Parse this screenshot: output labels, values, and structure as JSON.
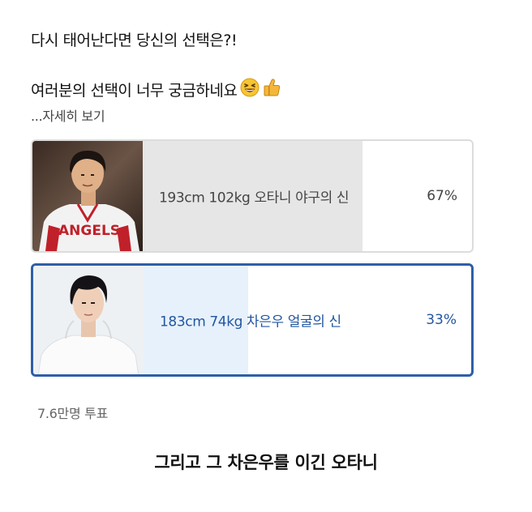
{
  "post": {
    "title": "다시 태어난다면 당신의 선택은?!",
    "body": "여러분의 선택이 너무 궁금하네요",
    "more_link": "...자세히 보기"
  },
  "poll": {
    "options": [
      {
        "label": "193cm 102kg 오타니 야구의 신",
        "percent": "67%",
        "selected": false
      },
      {
        "label": "183cm 74kg 차은우 얼굴의 신",
        "percent": "33%",
        "selected": true
      }
    ],
    "vote_count": "7.6만명 투표"
  },
  "caption": "그리고 그 차은우를 이긴 오타니",
  "colors": {
    "selected_border": "#2e5fa8",
    "selected_text": "#2356a0",
    "unselected_border": "#dcdcdc",
    "unselected_fill": "#e6e6e6",
    "selected_fill": "#e7f1fb"
  },
  "icons": [
    "grinning-squinting-face-emoji",
    "thumbs-up-emoji"
  ]
}
